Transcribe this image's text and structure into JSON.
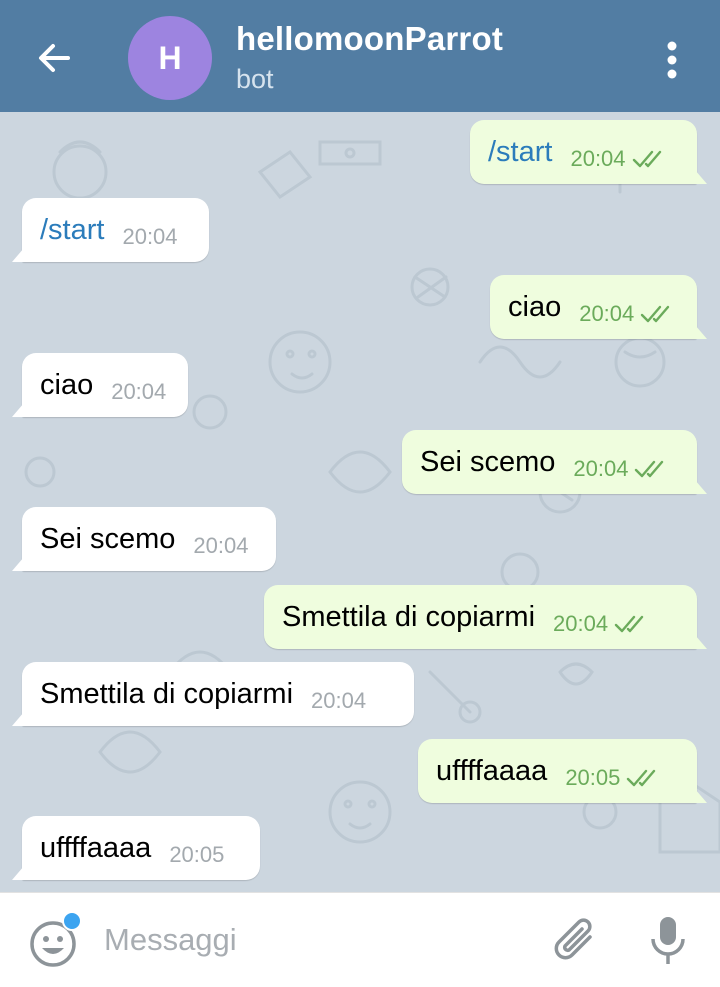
{
  "header": {
    "back_icon": "arrow-left-icon",
    "avatar_letter": "H",
    "avatar_color": "#9d84e0",
    "title": "hellomoonParrot",
    "subtitle": "bot",
    "menu_icon": "more-vertical-icon",
    "background_color": "#527da3"
  },
  "messages": [
    {
      "direction": "out",
      "text": "/start",
      "time": "20:04",
      "is_command": true,
      "read": true
    },
    {
      "direction": "in",
      "text": "/start",
      "time": "20:04",
      "is_command": true
    },
    {
      "direction": "out",
      "text": "ciao",
      "time": "20:04",
      "read": true
    },
    {
      "direction": "in",
      "text": "ciao",
      "time": "20:04"
    },
    {
      "direction": "out",
      "text": "Sei scemo",
      "time": "20:04",
      "read": true
    },
    {
      "direction": "in",
      "text": "Sei scemo",
      "time": "20:04"
    },
    {
      "direction": "out",
      "text": "Smettila di copiarmi",
      "time": "20:04",
      "read": true
    },
    {
      "direction": "in",
      "text": "Smettila di copiarmi",
      "time": "20:04"
    },
    {
      "direction": "out",
      "text": "uffffaaaa",
      "time": "20:05",
      "read": true
    },
    {
      "direction": "in",
      "text": "uffffaaaa",
      "time": "20:05"
    }
  ],
  "input": {
    "placeholder": "Messaggi",
    "value": "",
    "emoji_icon": "smiley-icon",
    "attach_icon": "paperclip-icon",
    "mic_icon": "microphone-icon"
  },
  "colors": {
    "chat_background": "#ccd6df",
    "outgoing_bubble": "#effdde",
    "incoming_bubble": "#ffffff",
    "command_text": "#2b7cbb",
    "outgoing_time": "#6bab5b"
  }
}
